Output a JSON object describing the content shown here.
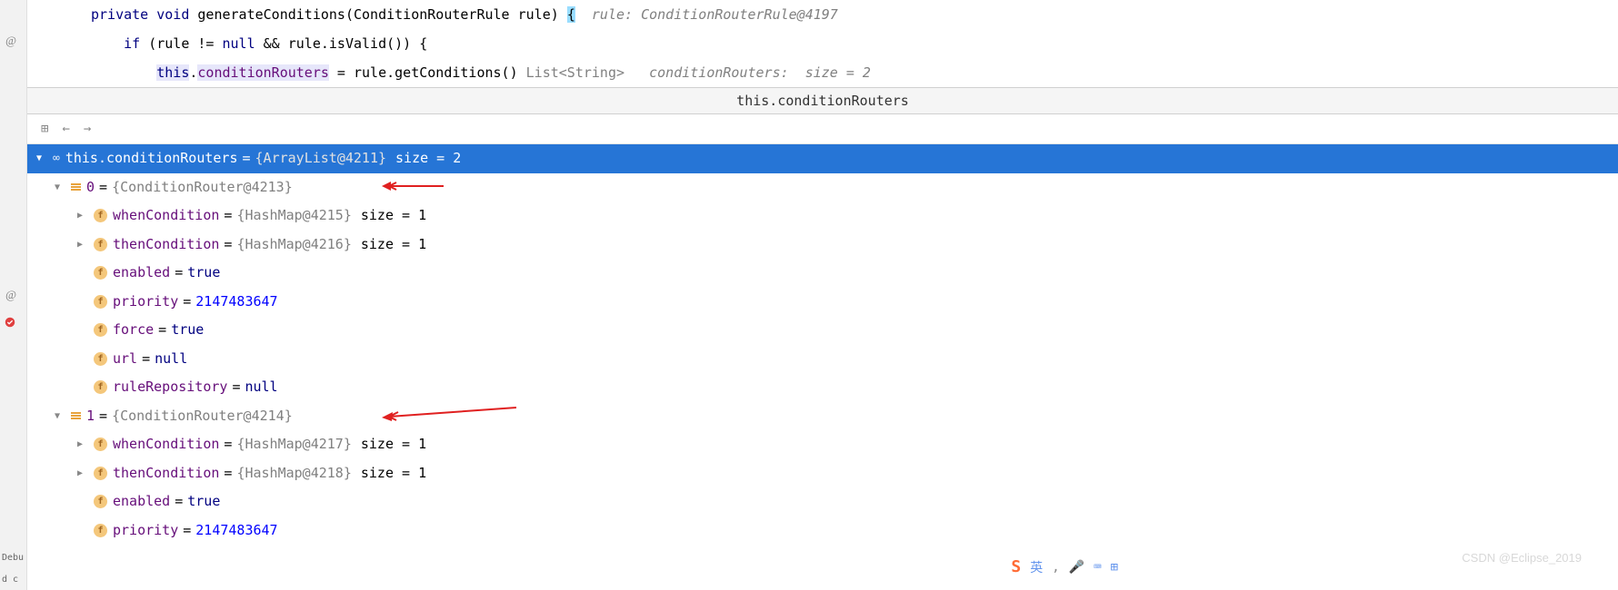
{
  "code": {
    "line1": {
      "kw1": "private",
      "kw2": "void",
      "method": "generateConditions",
      "params": "(ConditionRouterRule rule) ",
      "brace": "{",
      "hint": "  rule: ConditionRouterRule@4197"
    },
    "line2": {
      "indent": "    ",
      "kw": "if",
      "cond": " (rule != ",
      "null_kw": "null",
      "cond2": " && rule.isValid()) {"
    },
    "line3": {
      "indent": "        ",
      "this_kw": "this",
      "dot": ".",
      "field": "conditionRouters",
      "assign": " = rule.getConditions()",
      "type_hint": " List<String>",
      "comment": "   conditionRouters:  size = 2"
    }
  },
  "debugger": {
    "title": "this.conditionRouters"
  },
  "tree": {
    "root": {
      "name": "this.conditionRouters",
      "ref": "{ArrayList@4211}",
      "size": "size = 2"
    },
    "item0": {
      "idx": "0",
      "ref": "{ConditionRouter@4213}"
    },
    "item0_fields": [
      {
        "name": "whenCondition",
        "ref": "{HashMap@4215}",
        "size": "size = 1",
        "expandable": true
      },
      {
        "name": "thenCondition",
        "ref": "{HashMap@4216}",
        "size": "size = 1",
        "expandable": true
      },
      {
        "name": "enabled",
        "val": "true",
        "vtype": "bool"
      },
      {
        "name": "priority",
        "val": "2147483647",
        "vtype": "num"
      },
      {
        "name": "force",
        "val": "true",
        "vtype": "bool"
      },
      {
        "name": "url",
        "val": "null",
        "vtype": "null"
      },
      {
        "name": "ruleRepository",
        "val": "null",
        "vtype": "null"
      }
    ],
    "item1": {
      "idx": "1",
      "ref": "{ConditionRouter@4214}"
    },
    "item1_fields": [
      {
        "name": "whenCondition",
        "ref": "{HashMap@4217}",
        "size": "size = 1",
        "expandable": true
      },
      {
        "name": "thenCondition",
        "ref": "{HashMap@4218}",
        "size": "size = 1",
        "expandable": true
      },
      {
        "name": "enabled",
        "val": "true",
        "vtype": "bool"
      },
      {
        "name": "priority",
        "val": "2147483647",
        "vtype": "num"
      }
    ]
  },
  "watermark": "CSDN @Eclipse_2019",
  "ime": {
    "zh": "英",
    "icons": [
      "🎤",
      "⌨",
      "⊞"
    ]
  },
  "labels": {
    "debug": "Debu",
    "dc": "d c"
  }
}
